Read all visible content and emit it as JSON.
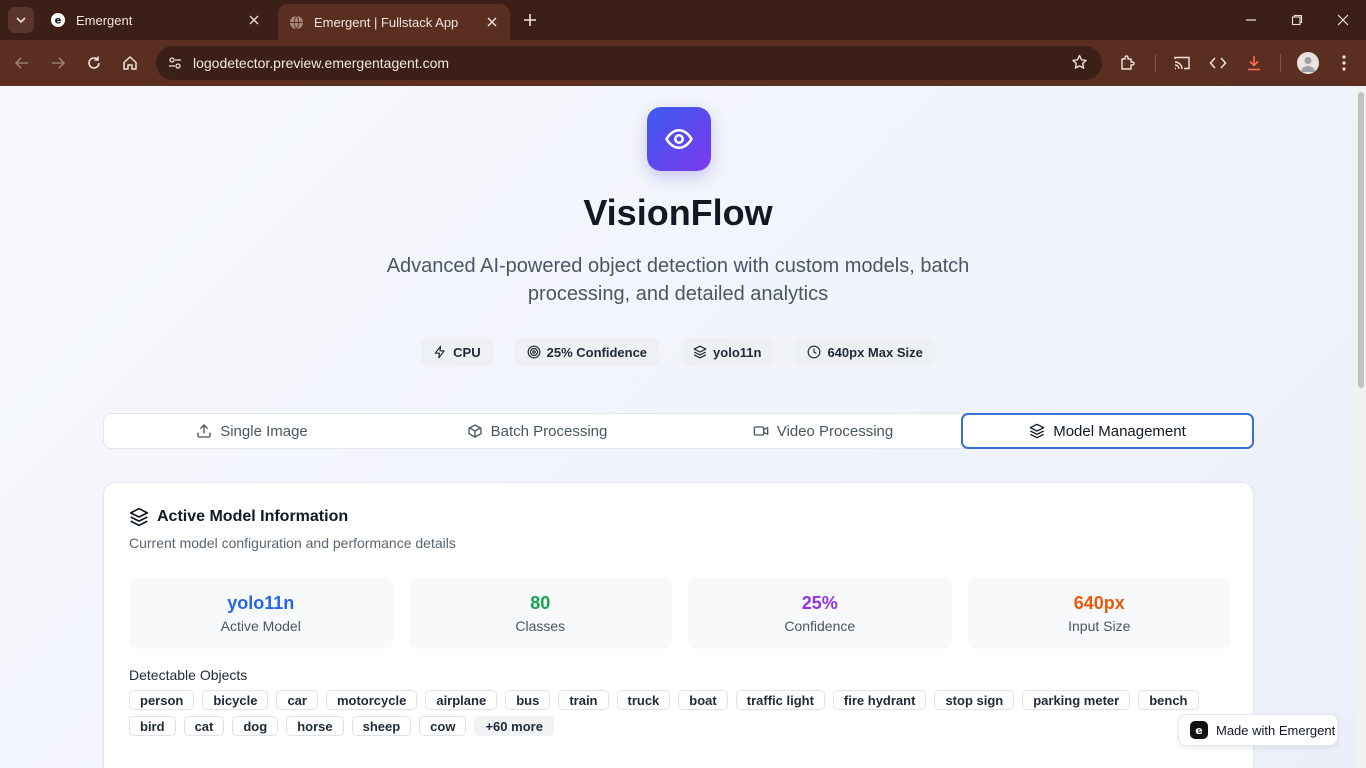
{
  "browser": {
    "tabs": [
      {
        "title": "Emergent",
        "active": false
      },
      {
        "title": "Emergent | Fullstack App",
        "active": true
      }
    ],
    "url": "logodetector.preview.emergentagent.com"
  },
  "hero": {
    "title": "VisionFlow",
    "subtitle": "Advanced AI-powered object detection with custom models, batch processing, and detailed analytics",
    "pills": [
      {
        "icon": "zap-icon",
        "label": "CPU"
      },
      {
        "icon": "target-icon",
        "label": "25% Confidence"
      },
      {
        "icon": "layers-icon",
        "label": "yolo11n"
      },
      {
        "icon": "clock-icon",
        "label": "640px Max Size"
      }
    ]
  },
  "tabs": [
    {
      "icon": "upload-icon",
      "label": "Single Image",
      "active": false
    },
    {
      "icon": "package-icon",
      "label": "Batch Processing",
      "active": false
    },
    {
      "icon": "video-icon",
      "label": "Video Processing",
      "active": false
    },
    {
      "icon": "layers-icon",
      "label": "Model Management",
      "active": true
    }
  ],
  "card": {
    "title": "Active Model Information",
    "description": "Current model configuration and performance details",
    "stats": [
      {
        "value": "yolo11n",
        "label": "Active Model",
        "color": "#2563eb"
      },
      {
        "value": "80",
        "label": "Classes",
        "color": "#16a34a"
      },
      {
        "value": "25%",
        "label": "Confidence",
        "color": "#9333ea"
      },
      {
        "value": "640px",
        "label": "Input Size",
        "color": "#ea580c"
      }
    ],
    "detectable_title": "Detectable Objects",
    "objects": [
      "person",
      "bicycle",
      "car",
      "motorcycle",
      "airplane",
      "bus",
      "train",
      "truck",
      "boat",
      "traffic light",
      "fire hydrant",
      "stop sign",
      "parking meter",
      "bench",
      "bird",
      "cat",
      "dog",
      "horse",
      "sheep",
      "cow"
    ],
    "more_label": "+60 more"
  },
  "badge": {
    "label": "Made with Emergent"
  },
  "colors": {
    "accent": "#3b6fd8",
    "logo_gradient_start": "#3b5bf0",
    "logo_gradient_end": "#7c3aed"
  }
}
